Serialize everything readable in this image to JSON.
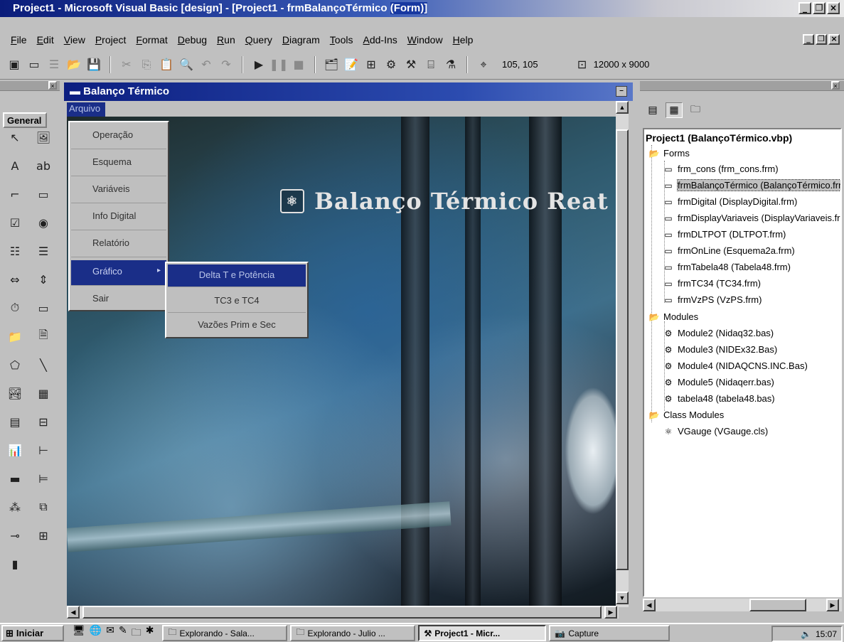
{
  "window": {
    "title_main": "Project1 - Microsoft Visual Basic [design] - [Project1 - frmBalançoTérmico ",
    "title_highlight": "(Form)]"
  },
  "menubar": [
    "File",
    "Edit",
    "View",
    "Project",
    "Format",
    "Debug",
    "Run",
    "Query",
    "Diagram",
    "Tools",
    "Add-Ins",
    "Window",
    "Help"
  ],
  "toolbar": {
    "position": "105, 105",
    "size": "12000 x 9000"
  },
  "toolbox": {
    "tab_label": "General"
  },
  "form": {
    "title": "Balanço Térmico",
    "menu_label": "Arquivo",
    "banner_text": "Balanço Térmico Reat",
    "menu_items": [
      {
        "label": "Operação"
      },
      {
        "label": "Esquema"
      },
      {
        "label": "Variáveis"
      },
      {
        "label": "Info Digital"
      },
      {
        "label": "Relatório"
      },
      {
        "label": "Gráfico",
        "submenu_arrow": "▸"
      },
      {
        "label": "Sair"
      }
    ],
    "submenu_items": [
      {
        "label": "Delta T e Potência"
      },
      {
        "label": "TC3 e TC4"
      },
      {
        "label": "Vazões Prim e Sec"
      }
    ]
  },
  "project": {
    "root": "Project1 (BalançoTérmico.vbp)",
    "folders": {
      "forms": "Forms",
      "modules": "Modules",
      "class_modules": "Class Modules"
    },
    "forms": [
      "frm_cons (frm_cons.frm)",
      "frmBalançoTérmico (BalançoTérmico.frm)",
      "frmDigital (DisplayDigital.frm)",
      "frmDisplayVariaveis (DisplayVariaveis.frm)",
      "frmDLTPOT (DLTPOT.frm)",
      "frmOnLine (Esquema2a.frm)",
      "frmTabela48 (Tabela48.frm)",
      "frmTC34 (TC34.frm)",
      "frmVzPS (VzPS.frm)"
    ],
    "modules": [
      "Module2 (Nidaq32.bas)",
      "Module3 (NIDEx32.Bas)",
      "Module4 (NIDAQCNS.INC.Bas)",
      "Module5 (Nidaqerr.bas)",
      "tabela48 (tabela48.bas)"
    ],
    "class_modules": [
      "VGauge (VGauge.cls)"
    ]
  },
  "taskbar": {
    "start_label": "Iniciar",
    "tasks": [
      "Explorando - Sala...",
      "Explorando - Julio ...",
      "Project1 - Micr...",
      "Capture"
    ],
    "clock": "15:07"
  },
  "colors": {
    "title_active": "#0a1c7a",
    "menu_highlight": "#1a2e88",
    "face": "#c0c0c0"
  }
}
